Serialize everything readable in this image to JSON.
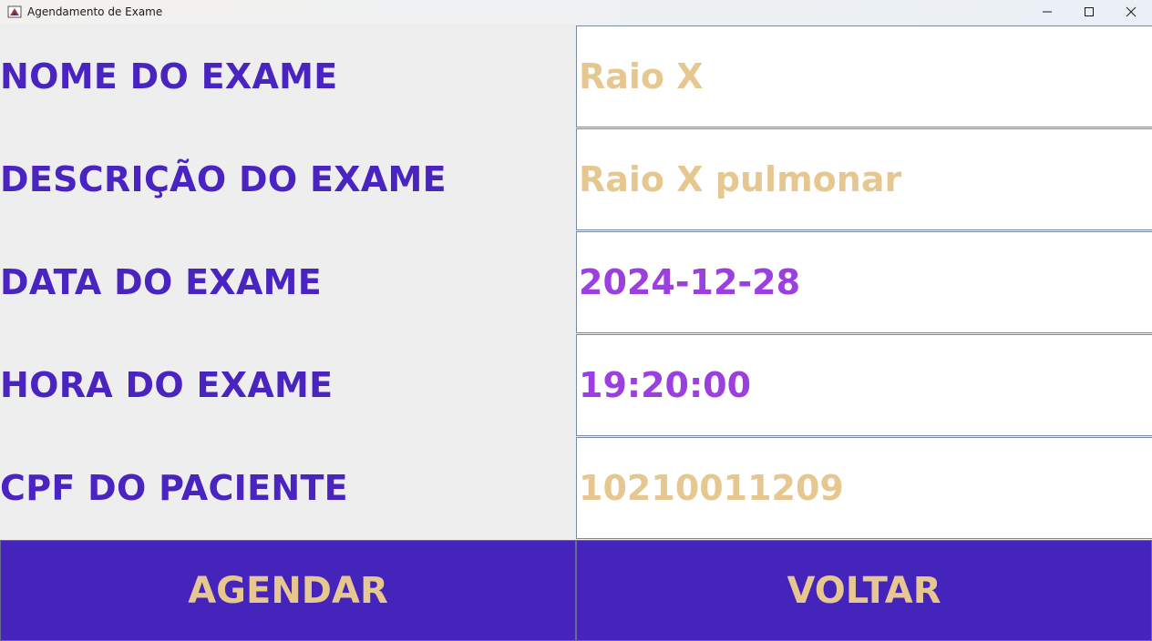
{
  "window": {
    "title": "Agendamento de Exame"
  },
  "colors": {
    "label": "#4a24c0",
    "value_placeholder": "#e6c78f",
    "value_entered": "#9b3fe0",
    "button_bg": "#4524bc",
    "button_text": "#e6c78f"
  },
  "form": {
    "rows": [
      {
        "label": "NOME DO EXAME",
        "value": "Raio X",
        "value_style": "placeholder"
      },
      {
        "label": "DESCRIÇÃO DO EXAME",
        "value": "Raio X pulmonar",
        "value_style": "placeholder"
      },
      {
        "label": "DATA DO EXAME",
        "value": "2024-12-28",
        "value_style": "entered"
      },
      {
        "label": "HORA DO EXAME",
        "value": "19:20:00",
        "value_style": "entered"
      },
      {
        "label": "CPF DO PACIENTE",
        "value": "10210011209",
        "value_style": "placeholder"
      }
    ]
  },
  "actions": {
    "schedule_label": "AGENDAR",
    "back_label": "VOLTAR"
  }
}
